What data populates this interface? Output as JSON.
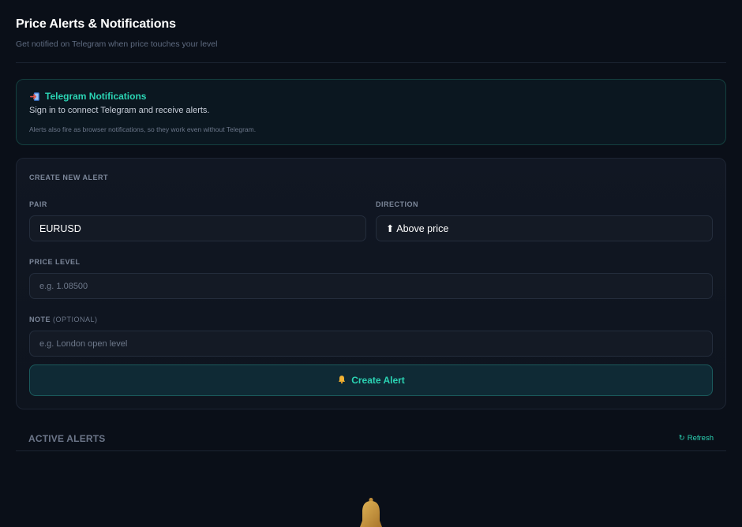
{
  "header": {
    "title": "Price Alerts & Notifications",
    "subtitle": "Get notified on Telegram when price touches your level"
  },
  "telegram": {
    "icon": "login-icon",
    "title": "Telegram Notifications",
    "signin_text": "Sign in to connect Telegram and receive alerts.",
    "note": "Alerts also fire as browser notifications, so they work even without Telegram."
  },
  "create_alert": {
    "section_title": "CREATE NEW ALERT",
    "pair_label": "PAIR",
    "pair_value": "EURUSD",
    "direction_label": "DIRECTION",
    "direction_value": "⬆ Above price",
    "price_label": "PRICE LEVEL",
    "price_placeholder": "e.g. 1.08500",
    "note_label": "NOTE",
    "note_optional": "(OPTIONAL)",
    "note_placeholder": "e.g. London open level",
    "button_label": "Create Alert",
    "button_icon": "bell-icon"
  },
  "active_alerts": {
    "title": "ACTIVE ALERTS",
    "refresh_icon": "↻",
    "refresh_label": "Refresh"
  },
  "colors": {
    "accent": "#2bd4b4",
    "background": "#0a0f18",
    "card": "#111723"
  }
}
